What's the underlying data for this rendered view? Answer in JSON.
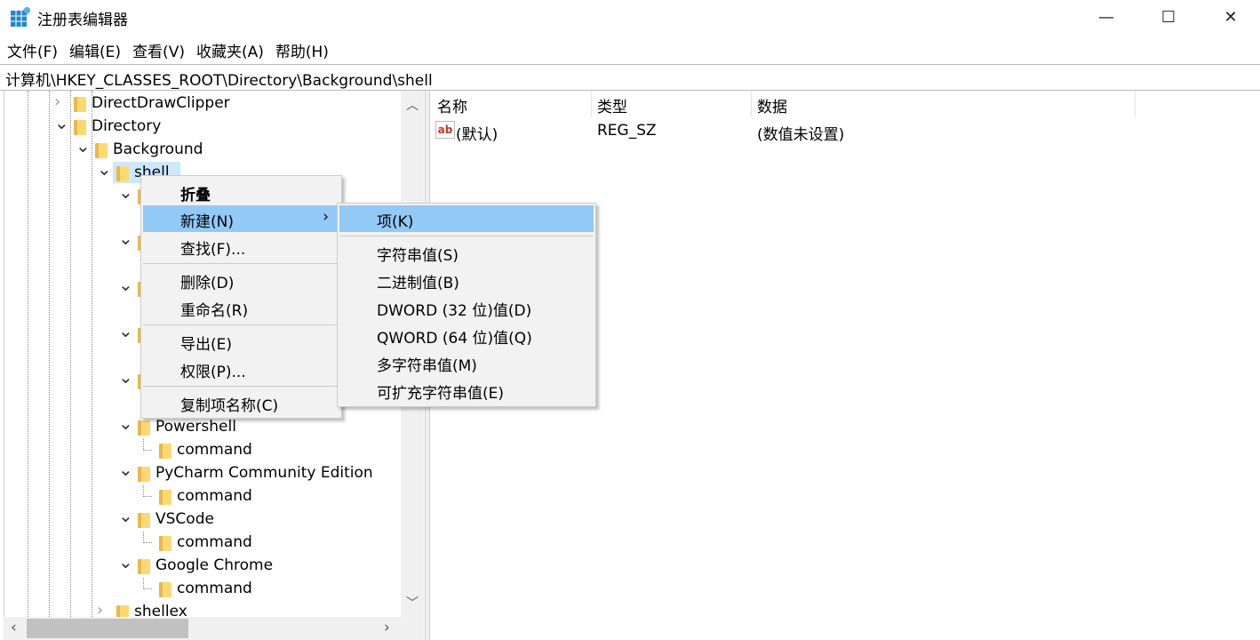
{
  "window": {
    "title": "注册表编辑器",
    "minimize": "—",
    "maximize": "☐",
    "close": "✕",
    "icon": "registry-editor-icon"
  },
  "menubar": [
    "文件(F)",
    "编辑(E)",
    "查看(V)",
    "收藏夹(A)",
    "帮助(H)"
  ],
  "address": "计算机\\HKEY_CLASSES_ROOT\\Directory\\Background\\shell",
  "tree": [
    {
      "label": "DirectDrawClipper",
      "level": 0,
      "state": "collapsed"
    },
    {
      "label": "Directory",
      "level": 0,
      "state": "expanded"
    },
    {
      "label": "Background",
      "level": 1,
      "state": "expanded"
    },
    {
      "label": "shell",
      "level": 2,
      "state": "expanded",
      "selected": true
    },
    {
      "label": "",
      "level": 3,
      "state": "expanded"
    },
    {
      "label": "",
      "level": 4,
      "state": "leaf"
    },
    {
      "label": "",
      "level": 3,
      "state": "expanded"
    },
    {
      "label": "",
      "level": 4,
      "state": "leaf"
    },
    {
      "label": "",
      "level": 3,
      "state": "expanded"
    },
    {
      "label": "",
      "level": 4,
      "state": "leaf"
    },
    {
      "label": "",
      "level": 3,
      "state": "expanded"
    },
    {
      "label": "",
      "level": 4,
      "state": "leaf"
    },
    {
      "label": "",
      "level": 3,
      "state": "expanded"
    },
    {
      "label": "",
      "level": 4,
      "state": "leaf"
    },
    {
      "label": "Powershell",
      "level": 3,
      "state": "expanded"
    },
    {
      "label": "command",
      "level": 4,
      "state": "leaf"
    },
    {
      "label": "PyCharm Community Edition",
      "level": 3,
      "state": "expanded"
    },
    {
      "label": "command",
      "level": 4,
      "state": "leaf"
    },
    {
      "label": "VSCode",
      "level": 3,
      "state": "expanded"
    },
    {
      "label": "command",
      "level": 4,
      "state": "leaf"
    },
    {
      "label": "Google Chrome",
      "level": 3,
      "state": "expanded"
    },
    {
      "label": "command",
      "level": 4,
      "state": "leaf"
    },
    {
      "label": "shellex",
      "level": 2,
      "state": "collapsed"
    }
  ],
  "list": {
    "columns": [
      "名称",
      "类型",
      "数据"
    ],
    "rows": [
      {
        "name": "(默认)",
        "type": "REG_SZ",
        "data": "(数值未设置)",
        "icon": "string-value-ab-icon"
      }
    ]
  },
  "context_menu": {
    "items": [
      "折叠",
      "新建(N)",
      "查找(F)...",
      "删除(D)",
      "重命名(R)",
      "导出(E)",
      "权限(P)...",
      "复制项名称(C)"
    ],
    "submenu_arrow": "›"
  },
  "submenu": {
    "items": [
      "项(K)",
      "字符串值(S)",
      "二进制值(B)",
      "DWORD (32 位)值(D)",
      "QWORD (64 位)值(Q)",
      "多字符串值(M)",
      "可扩充字符串值(E)"
    ]
  },
  "colors": {
    "selection": "#cce8ff",
    "menu_highlight": "#91c9f7",
    "folder": "#fcd874"
  }
}
